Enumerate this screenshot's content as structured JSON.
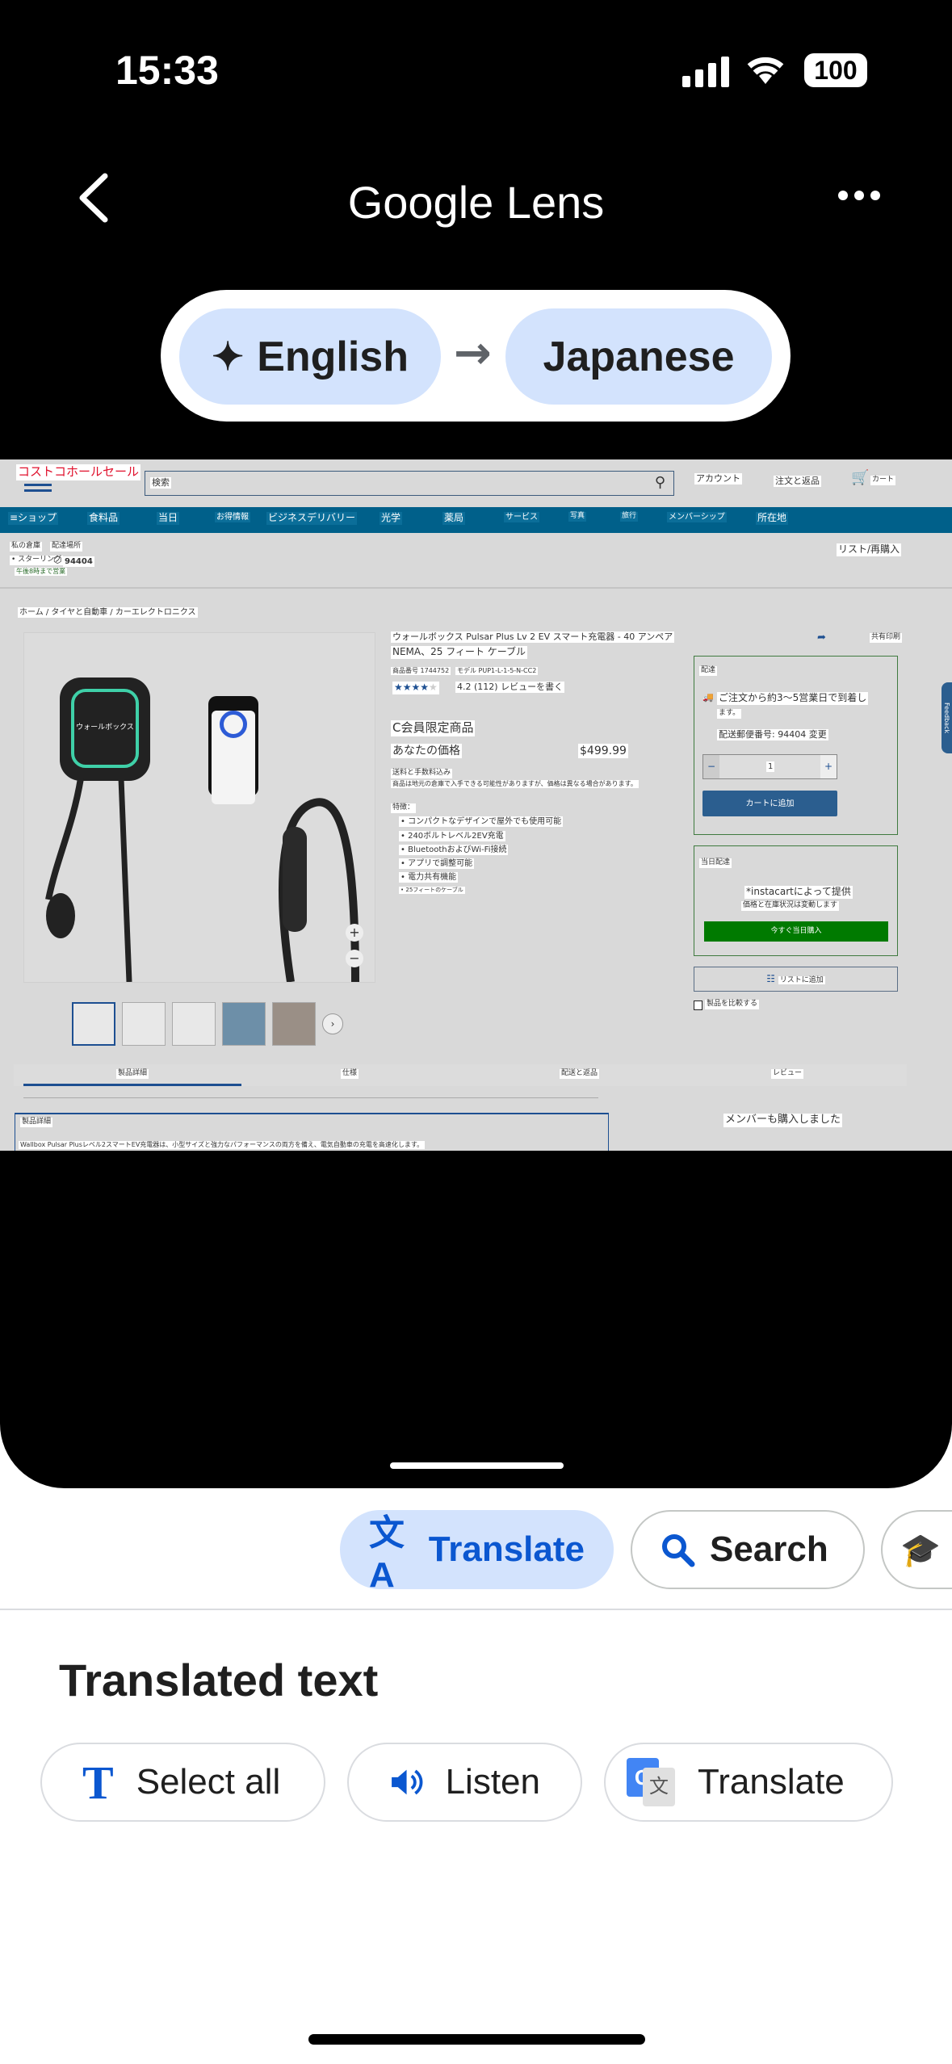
{
  "status": {
    "time": "15:33",
    "battery": "100"
  },
  "header": {
    "title": "Google Lens",
    "source_lang": "English",
    "target_lang": "Japanese"
  },
  "site": {
    "logo": "コストコホールセール",
    "search_placeholder": "検索",
    "account": "アカウント",
    "orders": "注文と返品",
    "cart": "カート",
    "nav": [
      "≡ショップ",
      "食料品",
      "当日",
      "お得情報",
      "ビジネスデリバリー",
      "光学",
      "薬局",
      "サービス",
      "写真",
      "旅行",
      "メンバーシップ",
      "所在地"
    ],
    "warehouse_label": "私の倉庫",
    "warehouse_name": "• スターリング",
    "warehouse_hours": "午後8時まで営業",
    "delivery_label": "配達場所",
    "zip": "94404",
    "list_reorder": "リスト/再購入",
    "breadcrumb": "ホーム / タイヤと自動車 / カーエレクトロニクス",
    "product": {
      "title_line1": "ウォールボックス Pulsar Plus Lv 2 EV スマート充電器 - 40 アンペア",
      "title_line2": "NEMA、25 フィート ケーブル",
      "item_no": "商品番号 1744752",
      "model": "モデル PUP1-L-1-5-N-CC2",
      "rating_text": "4.2 (112) レビューを書く",
      "members_only": "C会員限定商品",
      "your_price": "あなたの価格",
      "price": "$499.99",
      "shipping_incl": "送料と手数料込み",
      "note": "商品は地元の倉庫で入手できる可能性がありますが、価格は異なる場合があります。",
      "features_label": "特徴：",
      "features": [
        "コンパクトなデザインで屋外でも使用可能",
        "240ボルトレベル2EV充電",
        "BluetoothおよびWi-Fi接続",
        "アプリで調整可能",
        "電力共有機能",
        "25フィートのケーブル"
      ],
      "share": "共有印刷",
      "device_label": "ウォールボックス",
      "rating": 4.2
    },
    "delivery_box": {
      "title": "配達",
      "arrival": "ご注文から約3～5営業日で到着し",
      "arrival2": "ます。",
      "zip_line": "配送郵便番号: 94404 変更",
      "qty": "1",
      "add_to_cart": "カートに追加"
    },
    "sameday_box": {
      "title": "当日配達",
      "provider": "*instacartによって提供",
      "note": "価格と在庫状況は変動します",
      "buy_now": "今すぐ当日購入"
    },
    "add_list": "リストに追加",
    "compare": "製品を比較する",
    "feedback": "Feedback",
    "tabs": [
      "製品詳細",
      "仕様",
      "配送と返品",
      "レビュー"
    ],
    "details_title": "製品詳細",
    "details_text": "Wallbox Pulsar Plusレベル2スマートEV充電器は、小型サイズと強力なパフォーマンスの両方を備え、電気自動車の充電を高速化します。",
    "also_bought": "メンバーも購入しました"
  },
  "chips": {
    "translate": "Translate",
    "search": "Search"
  },
  "sheet": {
    "title": "Translated text",
    "select_all": "Select all",
    "listen": "Listen",
    "translate": "Translate"
  },
  "colors": {
    "accent": "#0b57d0",
    "pill": "#d3e3fd",
    "nav": "#00608a",
    "green": "#007a00"
  }
}
